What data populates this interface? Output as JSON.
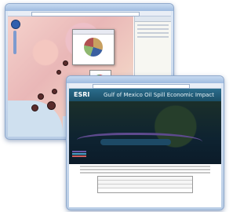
{
  "front_window": {
    "banner": {
      "logo": "ESRI",
      "title": "Gulf of Mexico Oil Spill Economic Impact"
    }
  },
  "colors": {
    "frame": "#b9cde6",
    "banner": "#1b4e66",
    "pie_segments": [
      "#c8a060",
      "#3a5fa0",
      "#8fb870",
      "#b05050"
    ]
  },
  "icons": [
    "zoom-slider-icon",
    "pie-chart-icon"
  ]
}
